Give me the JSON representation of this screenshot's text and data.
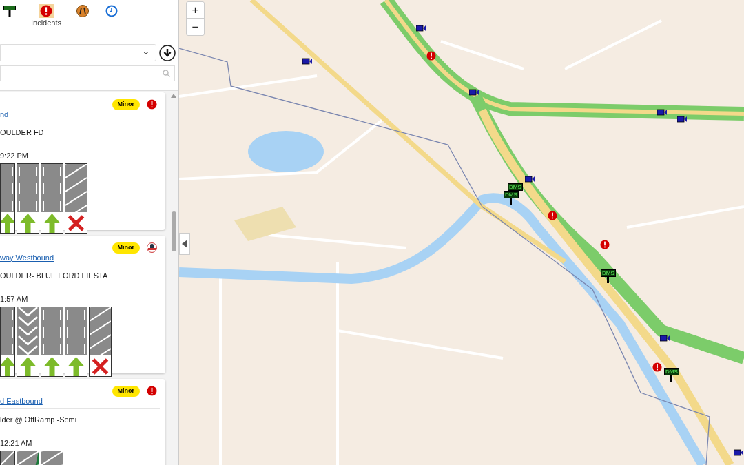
{
  "toolbar": {
    "items": [
      {
        "kind": "dms",
        "selected": false
      },
      {
        "kind": "incident",
        "label": "Incidents",
        "selected": true
      },
      {
        "kind": "construction",
        "selected": false
      },
      {
        "kind": "clock",
        "selected": false
      }
    ]
  },
  "filter": {
    "dropdown_caret": "⌄"
  },
  "incidents": [
    {
      "kind": "incident",
      "severity": "Minor",
      "title": "nd",
      "description": "OULDER FD",
      "time": "9:22 PM",
      "lanes": [
        {
          "kind": "open",
          "closed": false
        },
        {
          "kind": "open",
          "closed": false
        },
        {
          "kind": "open",
          "closed": false
        },
        {
          "kind": "shoulder",
          "closed": true
        }
      ]
    },
    {
      "kind": "roadside",
      "severity": "Minor",
      "title": "way Westbound",
      "description": "OULDER- BLUE FORD FIESTA",
      "time": "1:57 AM",
      "lanes": [
        {
          "kind": "open",
          "closed": false
        },
        {
          "kind": "hov",
          "closed": false
        },
        {
          "kind": "open",
          "closed": false
        },
        {
          "kind": "open",
          "closed": false
        },
        {
          "kind": "shoulder",
          "closed": true
        }
      ]
    },
    {
      "kind": "incident",
      "severity": "Minor",
      "title": "d Eastbound",
      "description": "lder @ OffRamp -Semi",
      "time": "12:21 AM",
      "lanes": [
        {
          "kind": "shoulder"
        },
        {
          "kind": "median"
        },
        {
          "kind": "shoulder"
        }
      ]
    }
  ],
  "map": {
    "zoom_in": "+",
    "zoom_out": "−",
    "markers": [
      {
        "kind": "camera"
      },
      {
        "kind": "camera"
      },
      {
        "kind": "camera"
      },
      {
        "kind": "camera"
      },
      {
        "kind": "camera"
      },
      {
        "kind": "camera"
      },
      {
        "kind": "camera"
      },
      {
        "kind": "camera"
      },
      {
        "kind": "incident"
      },
      {
        "kind": "incident"
      },
      {
        "kind": "incident"
      },
      {
        "kind": "incident"
      },
      {
        "kind": "dms",
        "label": "DMS"
      },
      {
        "kind": "dms",
        "label": "DMS"
      },
      {
        "kind": "dms",
        "label": "DMS"
      },
      {
        "kind": "dms",
        "label": "DMS"
      }
    ]
  }
}
